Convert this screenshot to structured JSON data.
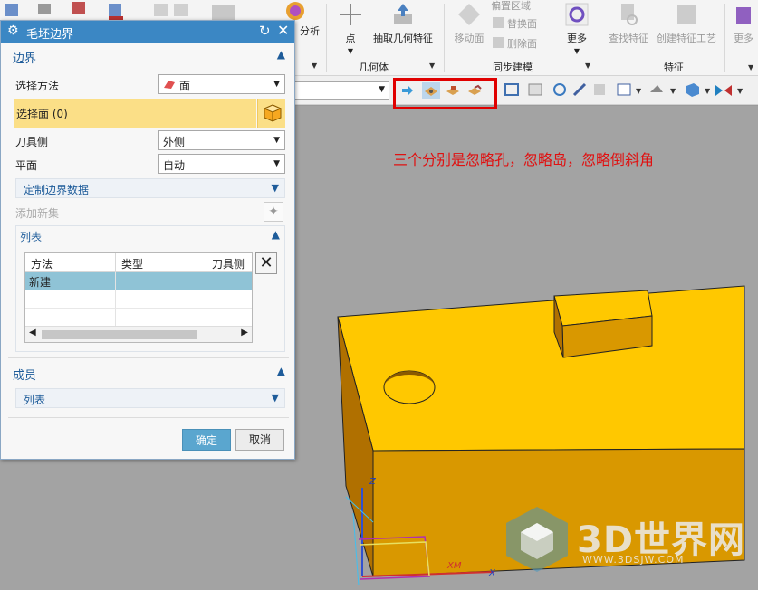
{
  "ribbon": {
    "analysis_label": "分析",
    "point_label": "点",
    "extract_label": "抽取几何特征",
    "geometry_group": "几何体",
    "move_face_label": "移动面",
    "select_region_label": "偏置区域",
    "replace_face_label": "替换面",
    "delete_face_label": "删除面",
    "sync_more_label": "更多",
    "sync_group": "同步建模",
    "find_feature_label": "查找特征",
    "create_feature_process_label": "创建特征工艺",
    "feature_group": "特征",
    "far_more_label": "更多"
  },
  "annotation": "三个分别是忽略孔，忽略岛，忽略倒斜角",
  "dialog": {
    "title": "毛坯边界",
    "section_boundary": "边界",
    "select_method_label": "选择方法",
    "select_method_value": "面",
    "select_face_label": "选择面 (0)",
    "tool_side_label": "刀具侧",
    "tool_side_value": "外侧",
    "plane_label": "平面",
    "plane_value": "自动",
    "custom_boundary_label": "定制边界数据",
    "add_new_set_label": "添加新集",
    "list_label": "列表",
    "table": {
      "columns": [
        "方法",
        "类型",
        "刀具侧"
      ],
      "rows": [
        [
          "新建",
          "",
          ""
        ],
        [
          "",
          "",
          ""
        ],
        [
          "",
          "",
          ""
        ]
      ]
    },
    "section_members": "成员",
    "members_list_label": "列表",
    "ok_label": "确定",
    "cancel_label": "取消"
  },
  "watermark": {
    "brand": "3D世界网",
    "url": "WWW.3DSJW.COM"
  },
  "axes": {
    "z_label": "Z",
    "xm_label": "XM",
    "x_label": "X"
  },
  "colors": {
    "title_bar": "#3b87c4",
    "highlight": "#fbdf87",
    "ok_button": "#5aa6cf",
    "annotation": "#e01010",
    "part_top": "#ffc800",
    "part_side": "#cf8f00"
  }
}
